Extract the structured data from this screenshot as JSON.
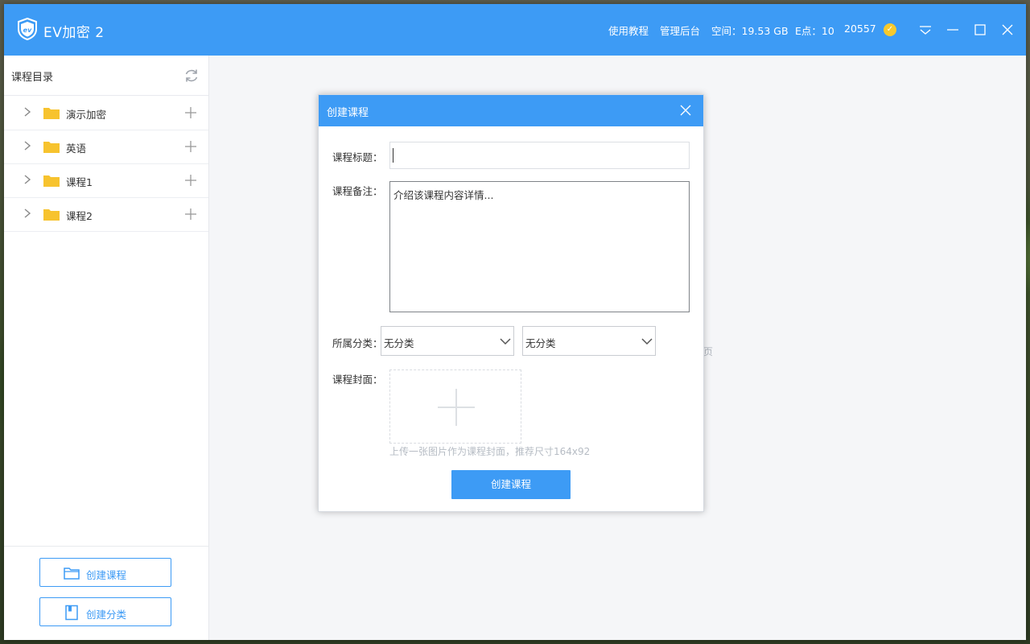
{
  "app": {
    "title": "EV加密 2",
    "links": {
      "tutorial": "使用教程",
      "admin": "管理后台",
      "space": "空间：19.53 GB",
      "epoints": "E点：10",
      "user_id": "20557"
    }
  },
  "sidebar": {
    "header": "课程目录",
    "items": [
      {
        "label": "演示加密"
      },
      {
        "label": "英语"
      },
      {
        "label": "课程1"
      },
      {
        "label": "课程2"
      }
    ],
    "buttons": {
      "create_course": "创建课程",
      "create_category": "创建分类"
    }
  },
  "dialog": {
    "title": "创建课程",
    "fields": {
      "title_label": "课程标题：",
      "title_value": "",
      "note_label": "课程备注：",
      "note_value": "介绍该课程内容详情...",
      "category_label": "所属分类：",
      "category_primary": "无分类",
      "category_secondary": "无分类",
      "cover_label": "课程封面：",
      "cover_tip": "上传一张图片作为课程封面，推荐尺寸164x92"
    },
    "submit_label": "创建课程"
  },
  "background": {
    "partial_text": "页"
  },
  "colors": {
    "accent": "#3d9bf5",
    "folder": "#f7c32e",
    "coin": "#f7c92c"
  }
}
